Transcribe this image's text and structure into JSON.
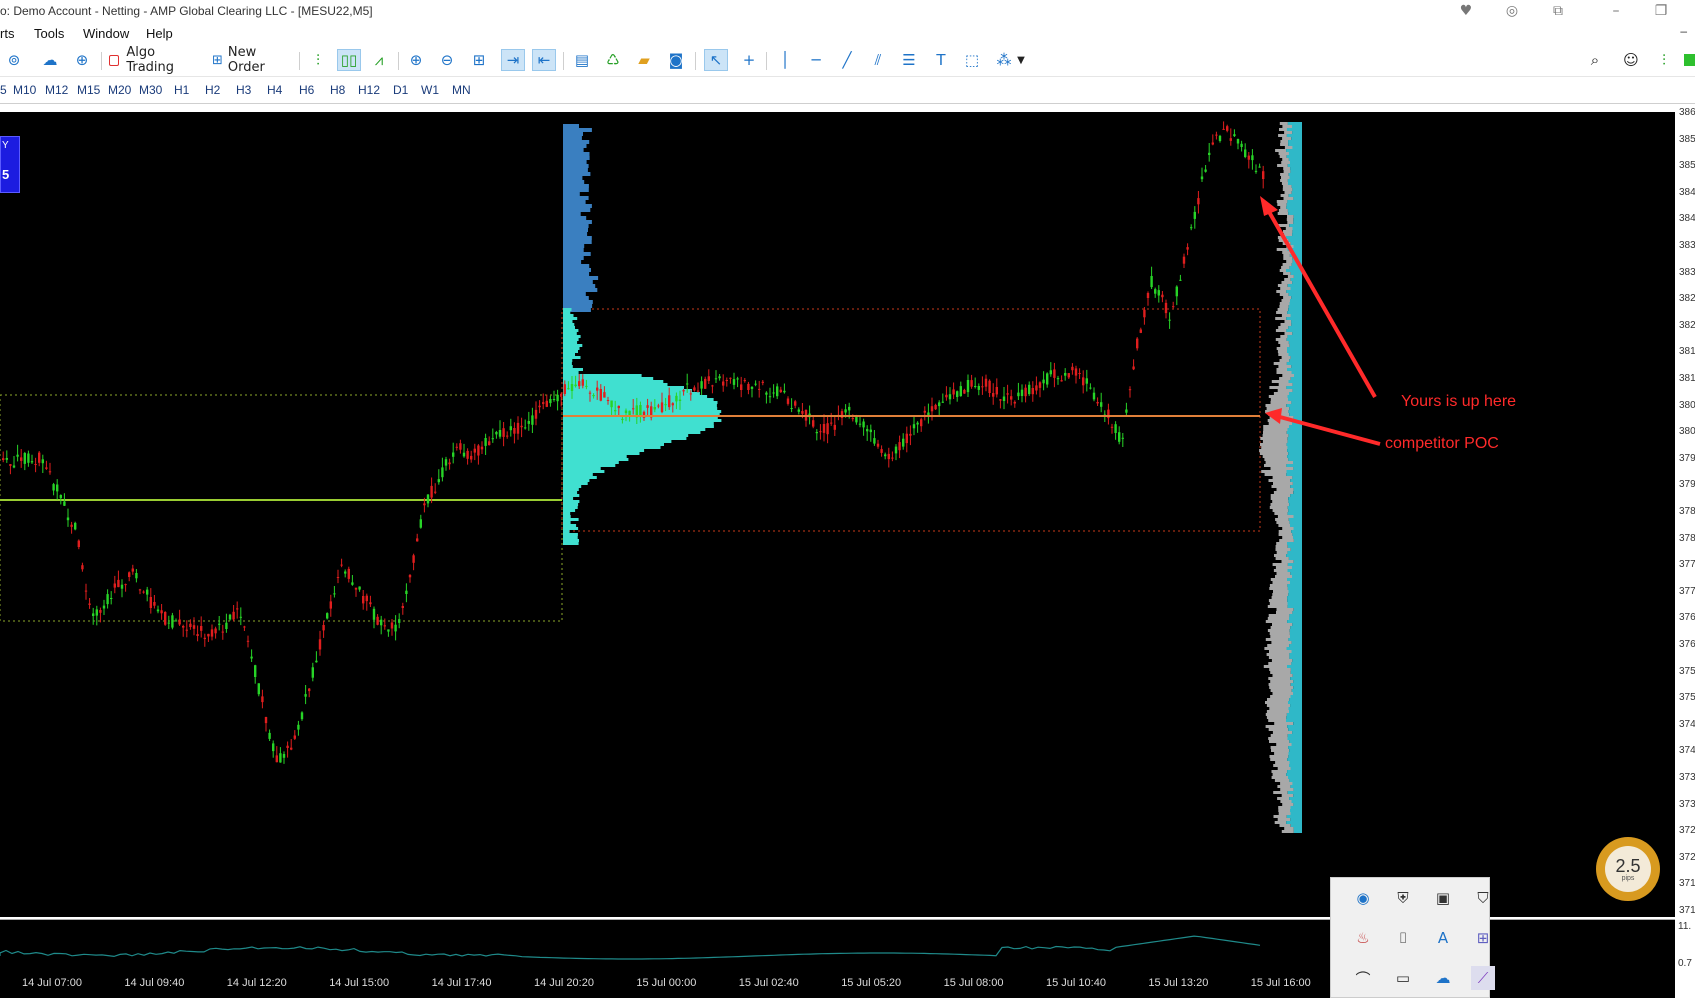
{
  "window": {
    "title": "o: Demo Account - Netting - AMP Global Clearing LLC - [MESU22,M5]"
  },
  "menu": {
    "items": [
      "rts",
      "Tools",
      "Window",
      "Help"
    ]
  },
  "toolbar": {
    "algo_trading_label": "Algo Trading",
    "new_order_label": "New Order"
  },
  "timeframes": [
    "5",
    "M10",
    "M12",
    "M15",
    "M20",
    "M30",
    "H1",
    "H2",
    "H3",
    "H4",
    "H6",
    "H8",
    "H12",
    "D1",
    "W1",
    "MN"
  ],
  "chart": {
    "symbol": "MESU22",
    "period": "M5",
    "buy_panel": {
      "label": "Y",
      "value": "5"
    },
    "annotations": {
      "yours": "Yours is up here",
      "competitor": "competitor POC"
    },
    "spread": {
      "value": "2.5",
      "unit": "pips"
    },
    "price_labels": [
      "386",
      "385",
      "385",
      "384",
      "384",
      "383",
      "383",
      "382",
      "382",
      "381",
      "381",
      "380",
      "380",
      "379",
      "379",
      "378",
      "378",
      "377",
      "377",
      "376",
      "376",
      "375",
      "375",
      "374",
      "374",
      "373",
      "373",
      "372",
      "372",
      "371",
      "371"
    ],
    "indicator_labels": [
      "11.",
      "0.7"
    ],
    "time_labels": [
      "14 Jul 07:00",
      "14 Jul 09:40",
      "14 Jul 12:20",
      "14 Jul 15:00",
      "14 Jul 17:40",
      "14 Jul 20:20",
      "15 Jul 00:00",
      "15 Jul 02:40",
      "15 Jul 05:20",
      "15 Jul 08:00",
      "15 Jul 10:40",
      "15 Jul 13:20",
      "15 Jul 16:00"
    ],
    "colors": {
      "background": "#000000",
      "bull": "#27d427",
      "bear": "#e01e1e",
      "profile_session": "#40e0d0",
      "profile_upper": "#3a7fc0",
      "profile_right": "#a8a8a8",
      "poc_line": "#e0803a",
      "value_area_box": "#c83a1a",
      "prev_poc_line": "#9acd32",
      "indicator_line": "#1f8a8a",
      "annotation": "#ff2a2a"
    }
  }
}
